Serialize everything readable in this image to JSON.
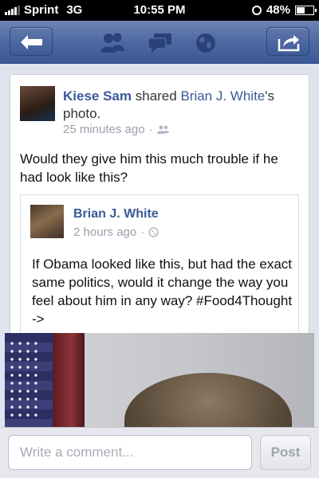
{
  "status_bar": {
    "carrier": "Sprint",
    "network": "3G",
    "time": "10:55 PM",
    "battery": "48%",
    "battery_level": 0.48
  },
  "nav": {
    "back_icon": "back-arrow-icon",
    "icons": [
      "friends-icon",
      "messages-icon",
      "globe-icon"
    ],
    "share_icon": "share-icon",
    "colors": {
      "bar": "#3b5998",
      "accent": "#6d84b4"
    }
  },
  "post": {
    "author": "Kiese Sam",
    "action": "shared",
    "shared_from": "Brian J. White",
    "possessive": "'s",
    "object": "photo.",
    "time": "25 minutes ago",
    "dot": "·",
    "audience_icon": "friends-audience-icon",
    "text": "Would they give him this much trouble if he had look like this?"
  },
  "shared_post": {
    "author": "Brian J. White",
    "time": "2 hours ago",
    "dot": "·",
    "audience_icon": "globe-audience-icon",
    "text": "If Obama looked like this, but had the exact same politics, would it change the way you feel about him in any way? #Food4Thought ->"
  },
  "comment": {
    "placeholder": "Write a comment...",
    "post_label": "Post"
  }
}
